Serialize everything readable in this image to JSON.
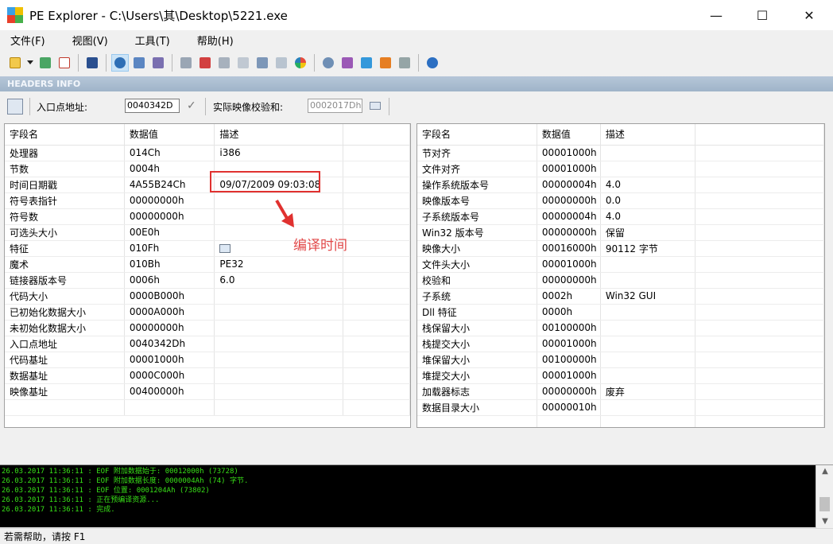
{
  "window": {
    "title": "PE Explorer - C:\\Users\\其\\Desktop\\5221.exe",
    "minimize": "—",
    "maximize": "☐",
    "close": "✕"
  },
  "menu": [
    "文件(F)",
    "视图(V)",
    "工具(T)",
    "帮助(H)"
  ],
  "section_header": "HEADERS INFO",
  "entry": {
    "entry_label": "入口点地址:",
    "entry_value": "0040342D",
    "checksum_label": "实际映像校验和:",
    "checksum_value": "0002017Dh"
  },
  "left_table": {
    "headers": [
      "字段名",
      "数据值",
      "描述"
    ],
    "rows": [
      [
        "处理器",
        "014Ch",
        "i386"
      ],
      [
        "节数",
        "0004h",
        ""
      ],
      [
        "时间日期戳",
        "4A55B24Ch",
        "09/07/2009  09:03:08"
      ],
      [
        "符号表指针",
        "00000000h",
        ""
      ],
      [
        "符号数",
        "00000000h",
        ""
      ],
      [
        "可选头大小",
        "00E0h",
        ""
      ],
      [
        "特征",
        "010Fh",
        ""
      ],
      [
        "魔术",
        "010Bh",
        "PE32"
      ],
      [
        "链接器版本号",
        "0006h",
        "6.0"
      ],
      [
        "代码大小",
        "0000B000h",
        ""
      ],
      [
        "已初始化数据大小",
        "0000A000h",
        ""
      ],
      [
        "未初始化数据大小",
        "00000000h",
        ""
      ],
      [
        "入口点地址",
        "0040342Dh",
        ""
      ],
      [
        "代码基址",
        "00001000h",
        ""
      ],
      [
        "数据基址",
        "0000C000h",
        ""
      ],
      [
        "映像基址",
        "00400000h",
        ""
      ]
    ]
  },
  "right_table": {
    "headers": [
      "字段名",
      "数据值",
      "描述"
    ],
    "rows": [
      [
        "节对齐",
        "00001000h",
        ""
      ],
      [
        "文件对齐",
        "00001000h",
        ""
      ],
      [
        "操作系统版本号",
        "00000004h",
        "4.0"
      ],
      [
        "映像版本号",
        "00000000h",
        "0.0"
      ],
      [
        "子系统版本号",
        "00000004h",
        "4.0"
      ],
      [
        "Win32 版本号",
        "00000000h",
        "保留"
      ],
      [
        "映像大小",
        "00016000h",
        "90112 字节"
      ],
      [
        "文件头大小",
        "00001000h",
        ""
      ],
      [
        "校验和",
        "00000000h",
        ""
      ],
      [
        "子系统",
        "0002h",
        "Win32 GUI"
      ],
      [
        "Dll 特征",
        "0000h",
        ""
      ],
      [
        "栈保留大小",
        "00100000h",
        ""
      ],
      [
        "栈提交大小",
        "00001000h",
        ""
      ],
      [
        "堆保留大小",
        "00100000h",
        ""
      ],
      [
        "堆提交大小",
        "00001000h",
        ""
      ],
      [
        "加载器标志",
        "00000000h",
        "废弃"
      ],
      [
        "数据目录大小",
        "00000010h",
        ""
      ]
    ]
  },
  "annotation": {
    "text": "编译时间",
    "color": "#e0312f"
  },
  "log": [
    "26.03.2017 11:36:11 : EOF 附加数据始于: 00012000h  (73728)",
    "26.03.2017 11:36:11 : EOF 附加数据长度: 0000004Ah  (74) 字节.",
    "26.03.2017 11:36:11 : EOF 位置: 0001204Ah  (73802)",
    "26.03.2017 11:36:11 : 正在预编译资源...",
    "26.03.2017 11:36:11 : 完成."
  ],
  "status": "若需帮助，请按 F1",
  "toolbar_icons": [
    "open-icon",
    "dropdown-arrow-icon",
    "refresh-icon",
    "close-file-icon",
    "save-icon",
    "info-icon",
    "tree-icon",
    "list-icon",
    "export-icon",
    "import-icon",
    "resource-icon",
    "section-icon",
    "dependency-icon",
    "diff-icon",
    "color-icon",
    "settings-icon",
    "tools-icon",
    "module-icon",
    "plugin-icon",
    "plugin2-icon",
    "help-icon"
  ],
  "colors": {
    "log_text": "#38e018",
    "header_bg": "#9fb4c9",
    "annotation": "#e0312f"
  }
}
